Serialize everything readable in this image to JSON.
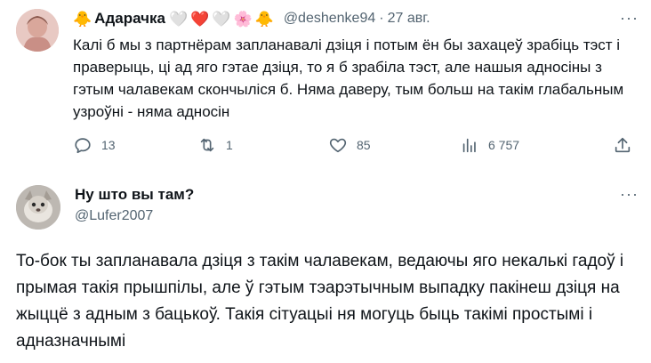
{
  "tweet": {
    "display_name": "Адарачка",
    "name_emojis": [
      "🐥",
      "🤍",
      "❤️",
      "🤍",
      "🌸",
      "🐥"
    ],
    "handle": "@deshenke94",
    "separator": "·",
    "date": "27 авг.",
    "more": "···",
    "text": "Калі б мы з партнёрам запланавалі дзіця і потым ён бы захацеў зрабіць тэст і праверыць, ці ад яго гэтае дзіця, то я б зрабіла тэст, але нашыя адносіны з гэтым чалавекам скончыліся б. Няма даверу, тым больш на такім глабальным узроўні - няма адносін",
    "actions": {
      "replies": "13",
      "retweets": "1",
      "likes": "85",
      "views": "6 757"
    }
  },
  "reply": {
    "display_name": "Ну што вы там?",
    "handle": "@Lufer2007",
    "more": "···",
    "text": "То-бок ты запланавала дзіця з такім чалавекам, ведаючы яго некалькі гадоў і прымая такія прышпілы, але ў гэтым тэарэтычным выпадку пакінеш дзіця на жыццё з адным з бацькоў. Такія сітуацыі ня могуць быць такімі простымі і адназначнымі"
  },
  "colors": {
    "text": "#0f1419",
    "secondary": "#536471",
    "background": "#ffffff"
  }
}
